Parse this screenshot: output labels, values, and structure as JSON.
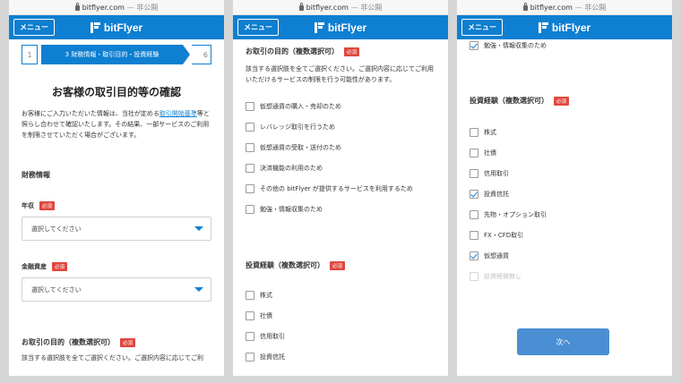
{
  "browser": {
    "domain": "bitflyer.com",
    "privacy": "— 非公開"
  },
  "header": {
    "menu_label": "メニュー",
    "logo_text": "bitFlyer",
    "color": "#0e7fd1"
  },
  "panel1": {
    "stepper": {
      "prev": "1",
      "current": "3 財務情報・取引目的・投資経験",
      "next": "6"
    },
    "title": "お客様の取引目的等の確認",
    "intro_before_link": "お客様にご入力いただいた情報は、当社が定める",
    "intro_link": "取引開始基準",
    "intro_after_link": "等と照らし合わせて確認いたします。その結果、一部サービスのご利用を制限させていただく場合がございます。",
    "finance_heading": "財務情報",
    "income_label": "年収",
    "income_value": "選択してください",
    "assets_label": "金融資産",
    "assets_value": "選択してください",
    "purpose_heading": "お取引の目的（複数選択可）",
    "purpose_cutoff": "該当する選択肢を全てご選択ください。ご選択内容に応じてご利",
    "required": "必須"
  },
  "panel2": {
    "purpose_heading": "お取引の目的（複数選択可）",
    "required": "必須",
    "purpose_desc": "該当する選択肢を全てご選択ください。ご選択内容に応じてご利用いただけるサービスの制限を行う可能性があります。",
    "purpose_options": [
      "仮想通貨の購入・売却のため",
      "レバレッジ取引を行うため",
      "仮想通貨の受取・送付のため",
      "決済機能の利用のため",
      "その他の bitFlyer が提供するサービスを利用するため",
      "勉強・情報収集のため"
    ],
    "experience_heading": "投資経験（複数選択可）",
    "experience_options": [
      "株式",
      "社債",
      "信用取引",
      "投資信託"
    ]
  },
  "panel3": {
    "top_option": "勉強・情報収集のため",
    "experience_heading": "投資経験（複数選択可）",
    "required": "必須",
    "experience_options": [
      {
        "label": "株式",
        "checked": false
      },
      {
        "label": "社債",
        "checked": false
      },
      {
        "label": "信用取引",
        "checked": false
      },
      {
        "label": "投資信託",
        "checked": true
      },
      {
        "label": "先物・オプション取引",
        "checked": false
      },
      {
        "label": "FX・CFD取引",
        "checked": false
      },
      {
        "label": "仮想通貨",
        "checked": true
      },
      {
        "label": "投資経験無し",
        "checked": false,
        "disabled": true
      }
    ],
    "next_label": "次へ"
  }
}
